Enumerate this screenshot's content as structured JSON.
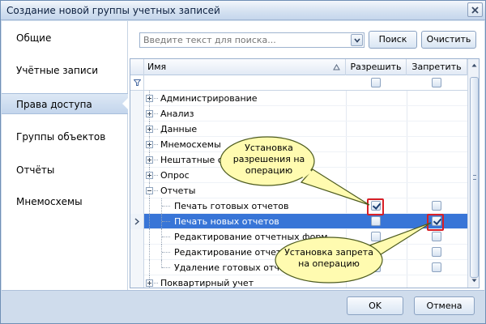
{
  "window": {
    "title": "Создание новой группы учетных записей",
    "close_icon": "close-icon"
  },
  "sidebar": {
    "items": [
      {
        "label": "Общие",
        "active": false
      },
      {
        "label": "Учётные записи",
        "active": false
      },
      {
        "label": "Права доступа",
        "active": true
      },
      {
        "label": "Группы объектов",
        "active": false
      },
      {
        "label": "Отчёты",
        "active": false
      },
      {
        "label": "Мнемосхемы",
        "active": false
      }
    ]
  },
  "search": {
    "placeholder": "Введите текст для поиска...",
    "value": "",
    "search_button": "Поиск",
    "clear_button": "Очистить"
  },
  "grid": {
    "columns": {
      "name": "Имя",
      "allow": "Разрешить",
      "deny": "Запретить"
    },
    "filter_icon": "filter-icon",
    "rows": [
      {
        "label": "Администрирование",
        "level": 0,
        "expander": "plus",
        "allow": null,
        "deny": null
      },
      {
        "label": "Анализ",
        "level": 0,
        "expander": "plus",
        "allow": null,
        "deny": null
      },
      {
        "label": "Данные",
        "level": 0,
        "expander": "plus",
        "allow": null,
        "deny": null
      },
      {
        "label": "Мнемосхемы",
        "level": 0,
        "expander": "plus",
        "allow": null,
        "deny": null
      },
      {
        "label": "Нештатные ситуации",
        "level": 0,
        "expander": "plus",
        "allow": null,
        "deny": null
      },
      {
        "label": "Опрос",
        "level": 0,
        "expander": "plus",
        "allow": null,
        "deny": null
      },
      {
        "label": "Отчеты",
        "level": 0,
        "expander": "minus",
        "allow": null,
        "deny": null
      },
      {
        "label": "Печать готовых отчетов",
        "level": 1,
        "expander": null,
        "allow": true,
        "deny": false
      },
      {
        "label": "Печать новых отчетов",
        "level": 1,
        "expander": null,
        "allow": false,
        "deny": true,
        "selected": true
      },
      {
        "label": "Редактирование отчетных форм",
        "level": 1,
        "expander": null,
        "allow": false,
        "deny": false
      },
      {
        "label": "Редактирование отчетов",
        "level": 1,
        "expander": null,
        "allow": false,
        "deny": false
      },
      {
        "label": "Удаление готовых отчетов",
        "level": 1,
        "expander": null,
        "allow": false,
        "deny": false
      },
      {
        "label": "Поквартирный учет",
        "level": 0,
        "expander": "plus",
        "allow": null,
        "deny": null
      }
    ]
  },
  "callouts": {
    "allow": [
      "Установка",
      "разрешения на",
      "операцию"
    ],
    "deny": [
      "Установка запрета",
      "на операцию"
    ],
    "colors": {
      "fill": "#fffbb0",
      "stroke": "#4d5b1e"
    }
  },
  "footer": {
    "ok_button": "OK",
    "cancel_button": "Отмена"
  }
}
